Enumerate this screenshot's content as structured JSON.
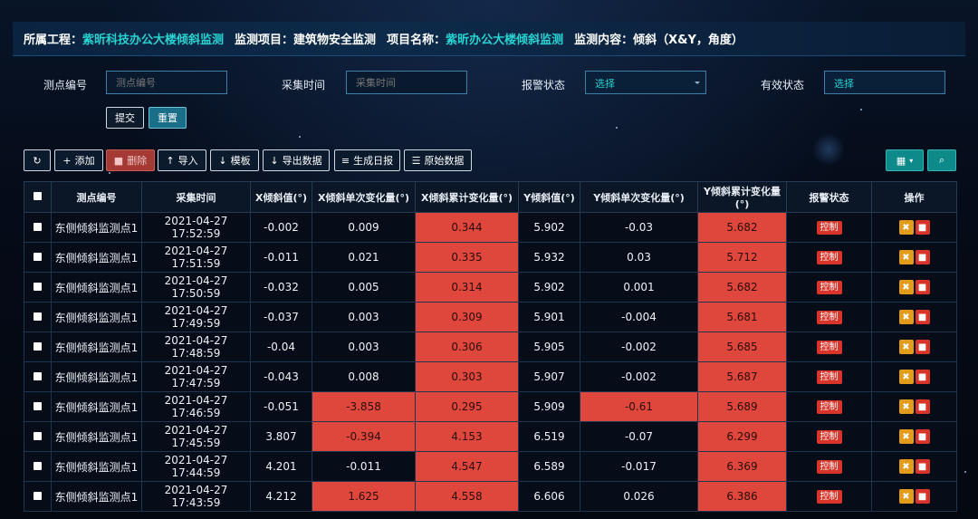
{
  "header": {
    "project_label": "所属工程：",
    "project_value": "紫昕科技办公大楼倾斜监测",
    "item_label": "监测项目：",
    "item_value": "建筑物安全监测",
    "name_label": "项目名称：",
    "name_value": "紫昕办公大楼倾斜监测",
    "content_text": "监测内容：倾斜（X&Y，角度）"
  },
  "filters": {
    "point_label": "测点编号",
    "point_placeholder": "测点编号",
    "time_label": "采集时间",
    "time_placeholder": "采集时间",
    "alarm_label": "报警状态",
    "alarm_value": "选择",
    "valid_label": "有效状态",
    "valid_value": "选择",
    "submit": "提交",
    "reset": "重置"
  },
  "toolbar": {
    "refresh_icon": "refresh-icon",
    "add": "添加",
    "delete": "删除",
    "import": "导入",
    "template": "模板",
    "export": "导出数据",
    "daily": "生成日报",
    "raw": "原始数据",
    "columns_icon": "grid-icon",
    "search_icon": "search-icon"
  },
  "table": {
    "headers": [
      "测点编号",
      "采集时间",
      "X倾斜值(°)",
      "X倾斜单次变化量(°)",
      "X倾斜累计变化量(°)",
      "Y倾斜值(°)",
      "Y倾斜单次变化量(°)",
      "Y倾斜累计变化量(°)",
      "报警状态",
      "操作"
    ],
    "alarm_badge": "控制",
    "highlight_color": "#e0473c",
    "rows": [
      {
        "point": "东侧倾斜监测点1",
        "time": "2021-04-27 17:52:59",
        "x": "-0.002",
        "xs": "0.009",
        "xc": "0.344",
        "y": "5.902",
        "ys": "-0.03",
        "yc": "5.682",
        "hl_xs": false,
        "hl_ys": false
      },
      {
        "point": "东侧倾斜监测点1",
        "time": "2021-04-27 17:51:59",
        "x": "-0.011",
        "xs": "0.021",
        "xc": "0.335",
        "y": "5.932",
        "ys": "0.03",
        "yc": "5.712",
        "hl_xs": false,
        "hl_ys": false
      },
      {
        "point": "东侧倾斜监测点1",
        "time": "2021-04-27 17:50:59",
        "x": "-0.032",
        "xs": "0.005",
        "xc": "0.314",
        "y": "5.902",
        "ys": "0.001",
        "yc": "5.682",
        "hl_xs": false,
        "hl_ys": false
      },
      {
        "point": "东侧倾斜监测点1",
        "time": "2021-04-27 17:49:59",
        "x": "-0.037",
        "xs": "0.003",
        "xc": "0.309",
        "y": "5.901",
        "ys": "-0.004",
        "yc": "5.681",
        "hl_xs": false,
        "hl_ys": false
      },
      {
        "point": "东侧倾斜监测点1",
        "time": "2021-04-27 17:48:59",
        "x": "-0.04",
        "xs": "0.003",
        "xc": "0.306",
        "y": "5.905",
        "ys": "-0.002",
        "yc": "5.685",
        "hl_xs": false,
        "hl_ys": false
      },
      {
        "point": "东侧倾斜监测点1",
        "time": "2021-04-27 17:47:59",
        "x": "-0.043",
        "xs": "0.008",
        "xc": "0.303",
        "y": "5.907",
        "ys": "-0.002",
        "yc": "5.687",
        "hl_xs": false,
        "hl_ys": false
      },
      {
        "point": "东侧倾斜监测点1",
        "time": "2021-04-27 17:46:59",
        "x": "-0.051",
        "xs": "-3.858",
        "xc": "0.295",
        "y": "5.909",
        "ys": "-0.61",
        "yc": "5.689",
        "hl_xs": true,
        "hl_ys": true
      },
      {
        "point": "东侧倾斜监测点1",
        "time": "2021-04-27 17:45:59",
        "x": "3.807",
        "xs": "-0.394",
        "xc": "4.153",
        "y": "6.519",
        "ys": "-0.07",
        "yc": "6.299",
        "hl_xs": true,
        "hl_ys": false
      },
      {
        "point": "东侧倾斜监测点1",
        "time": "2021-04-27 17:44:59",
        "x": "4.201",
        "xs": "-0.011",
        "xc": "4.547",
        "y": "6.589",
        "ys": "-0.017",
        "yc": "6.369",
        "hl_xs": false,
        "hl_ys": false
      },
      {
        "point": "东侧倾斜监测点1",
        "time": "2021-04-27 17:43:59",
        "x": "4.212",
        "xs": "1.625",
        "xc": "4.558",
        "y": "6.606",
        "ys": "0.026",
        "yc": "6.386",
        "hl_xs": true,
        "hl_ys": false
      }
    ]
  }
}
